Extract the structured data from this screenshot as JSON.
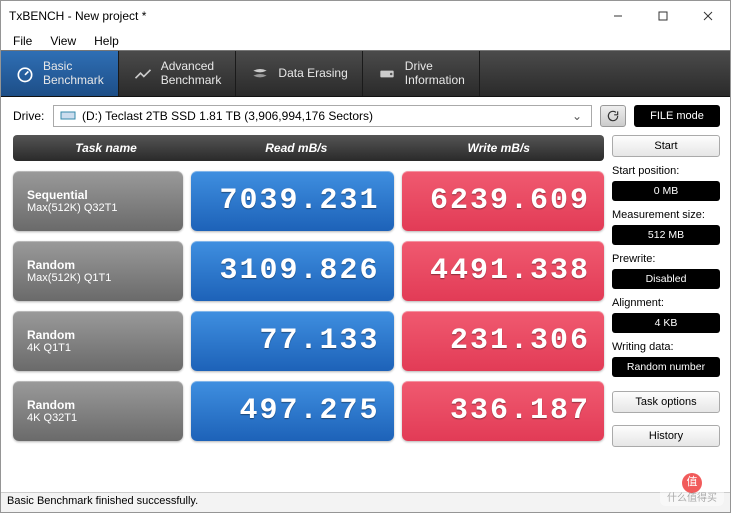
{
  "window": {
    "title": "TxBENCH - New project *"
  },
  "menu": {
    "file": "File",
    "view": "View",
    "help": "Help"
  },
  "tools": {
    "basic": "Basic\nBenchmark",
    "advanced": "Advanced\nBenchmark",
    "erasing": "Data Erasing",
    "drive": "Drive\nInformation"
  },
  "drive": {
    "label": "Drive:",
    "value": "(D:) Teclast 2TB SSD  1.81 TB (3,906,994,176 Sectors)",
    "filemode": "FILE mode"
  },
  "headers": {
    "task": "Task name",
    "read": "Read mB/s",
    "write": "Write mB/s"
  },
  "rows": [
    {
      "t1": "Sequential",
      "t2": "Max(512K) Q32T1",
      "read": "7039.231",
      "write": "6239.609"
    },
    {
      "t1": "Random",
      "t2": "Max(512K) Q1T1",
      "read": "3109.826",
      "write": "4491.338"
    },
    {
      "t1": "Random",
      "t2": "4K Q1T1",
      "read": "77.133",
      "write": "231.306"
    },
    {
      "t1": "Random",
      "t2": "4K Q32T1",
      "read": "497.275",
      "write": "336.187"
    }
  ],
  "side": {
    "start": "Start",
    "startpos_l": "Start position:",
    "startpos_v": "0 MB",
    "meas_l": "Measurement size:",
    "meas_v": "512 MB",
    "prewrite_l": "Prewrite:",
    "prewrite_v": "Disabled",
    "align_l": "Alignment:",
    "align_v": "4 KB",
    "wdata_l": "Writing data:",
    "wdata_v": "Random number",
    "taskopt": "Task options",
    "history": "History"
  },
  "status": "Basic Benchmark finished successfully.",
  "watermark": "什么值得买"
}
